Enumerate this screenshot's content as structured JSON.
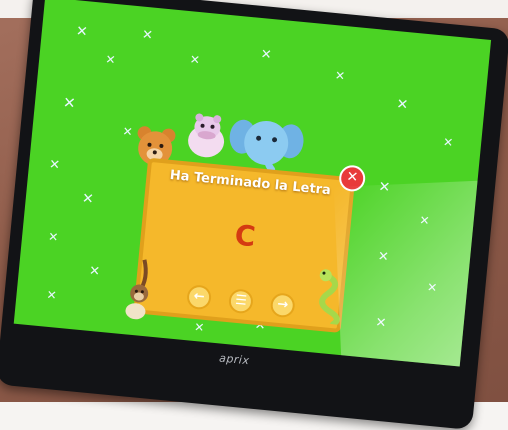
{
  "dialog": {
    "title": "Ha Terminado la Letra",
    "letter": "C",
    "close_icon": "close-icon",
    "prev_icon": "arrow-left-icon",
    "menu_icon": "list-icon",
    "next_icon": "arrow-right-icon"
  },
  "device": {
    "brand": "aprix"
  },
  "colors": {
    "screen_background": "#4bd324",
    "card": "#f5b82b",
    "letter": "#d43a12",
    "close_button": "#e83a3a"
  }
}
